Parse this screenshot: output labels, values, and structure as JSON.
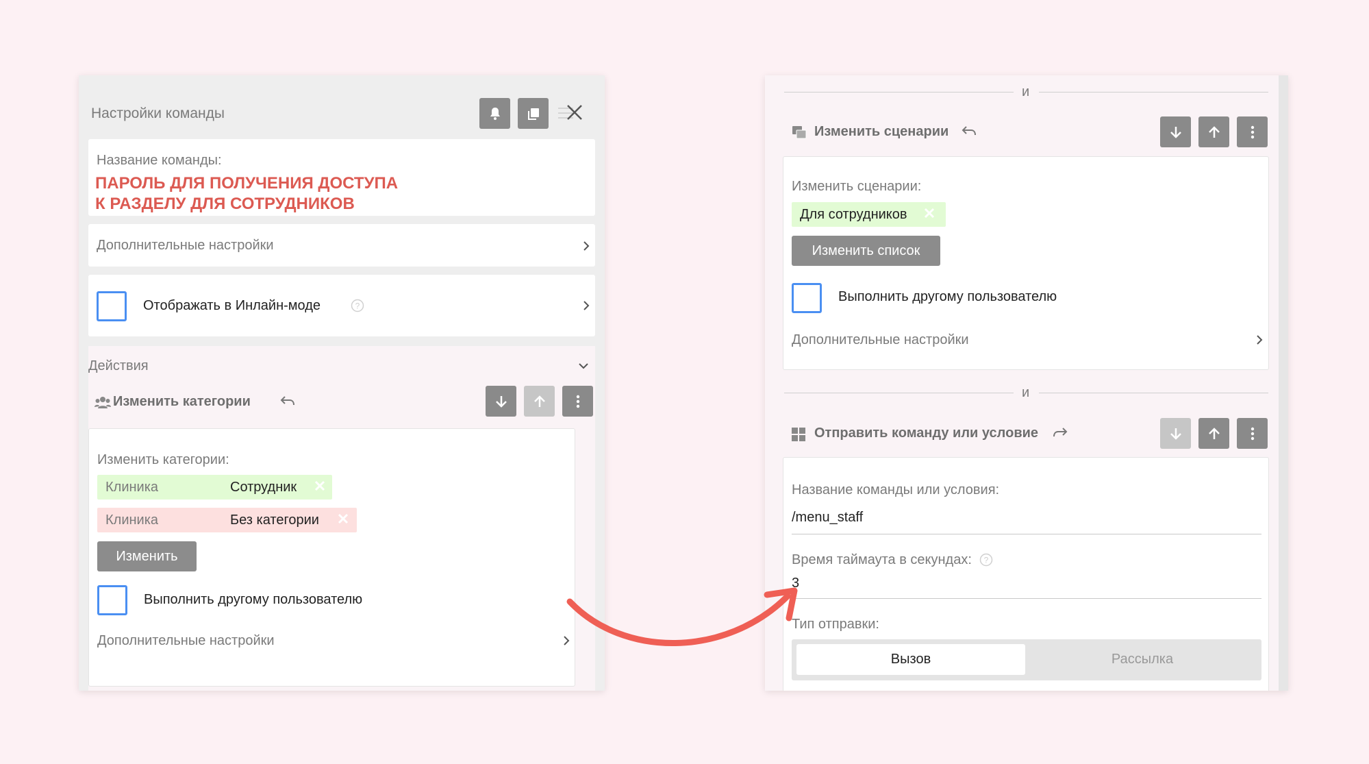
{
  "left": {
    "header_title": "Настройки команды",
    "name_label": "Название команды:",
    "name_value_line1": "ПАРОЛЬ ДЛЯ ПОЛУЧЕНИЯ ДОСТУПА",
    "name_value_line2": "К РАЗДЕЛУ ДЛЯ СОТРУДНИКОВ",
    "extra_settings": "Дополнительные настройки",
    "inline_mode": "Отображать в Инлайн-моде",
    "actions_title": "Действия",
    "action_title": "Изменить категории",
    "categories_label": "Изменить категории:",
    "categories": [
      {
        "group": "Клиника",
        "value": "Сотрудник",
        "color": "#e2fbd4"
      },
      {
        "group": "Клиника",
        "value": "Без категории",
        "color": "#fde0df"
      }
    ],
    "change_button": "Изменить",
    "run_other_user": "Выполнить другому пользователю",
    "action_extra_settings": "Дополнительные настройки"
  },
  "right": {
    "and_label_1": "и",
    "scenarios_action_title": "Изменить сценарии",
    "scenarios_label": "Изменить сценарии:",
    "scenario_chip": "Для сотрудников",
    "change_list_button": "Изменить список",
    "run_other_user": "Выполнить другому пользователю",
    "extra_settings": "Дополнительные настройки",
    "and_label_2": "и",
    "send_action_title": "Отправить команду или условие",
    "command_label": "Название команды или условия:",
    "command_value": "/menu_staff",
    "timeout_label": "Время таймаута в секундах:",
    "timeout_value": "3",
    "send_type_label": "Тип отправки:",
    "send_type_options": [
      "Вызов",
      "Рассылка"
    ],
    "send_type_selected": "Вызов"
  },
  "colors": {
    "accent_red": "#dc5a52",
    "checkbox_blue": "#4a8ff2",
    "arrow": "#ef5f55"
  }
}
